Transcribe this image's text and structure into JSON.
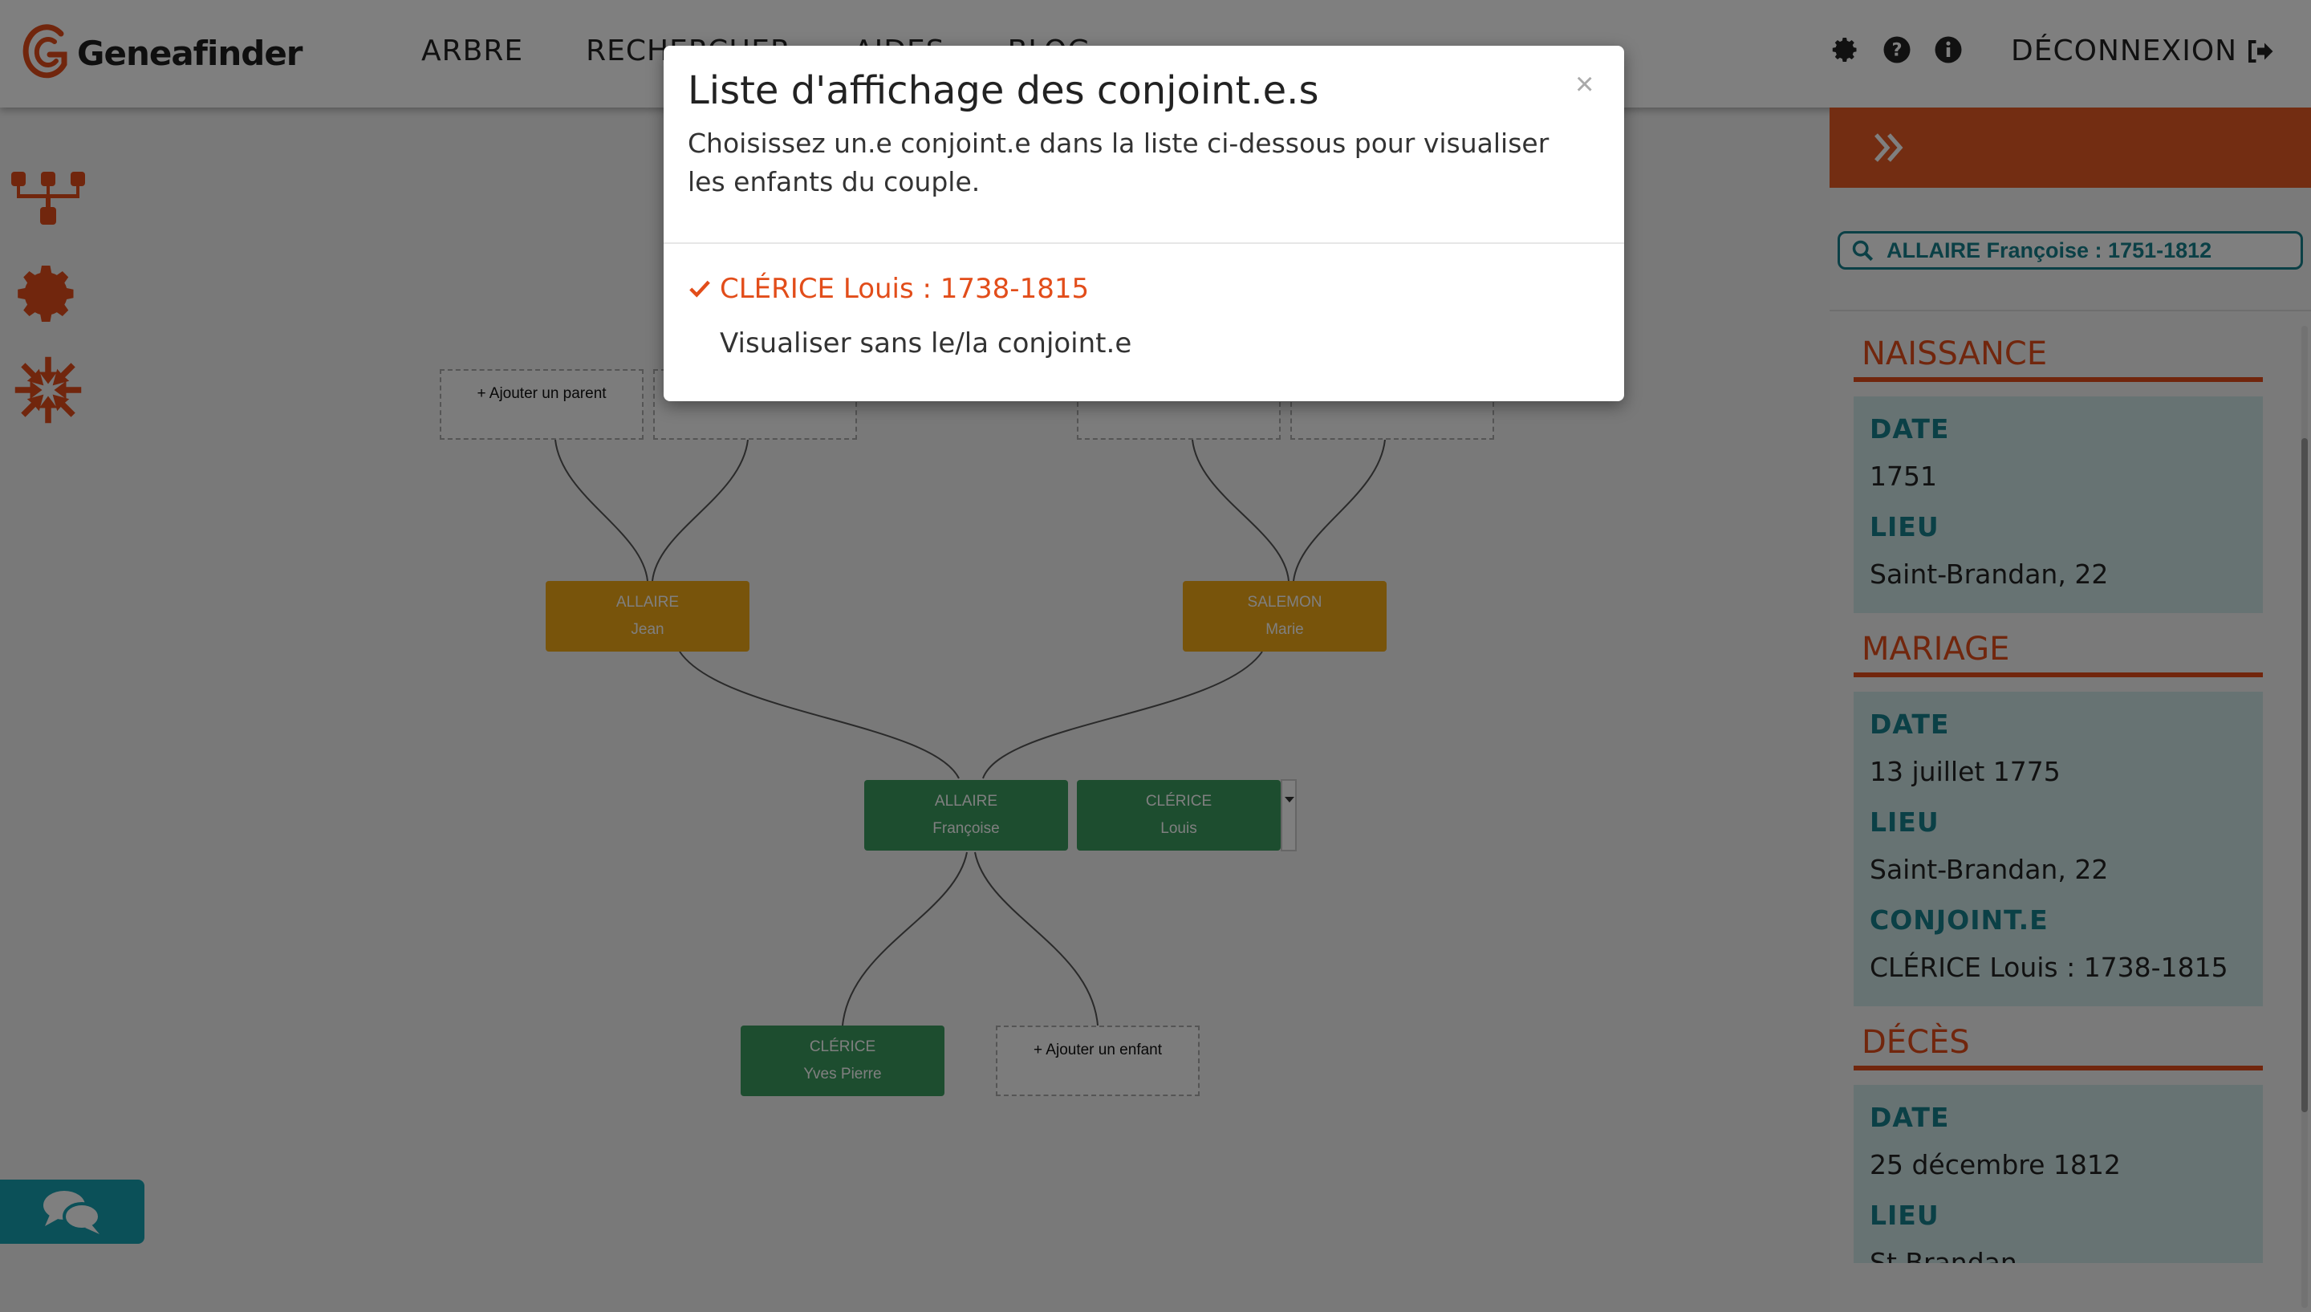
{
  "header": {
    "brand": "Geneafinder",
    "nav": [
      "ARBRE",
      "RECHERCHER",
      "AIDES",
      "BLOG"
    ],
    "logout_label": "DÉCONNEXION"
  },
  "icons": {
    "brand_color": "#e24d1a",
    "accent_teal": "#17808d",
    "person_yellow": "#f0a817",
    "person_green": "#3a9a5e"
  },
  "tree": {
    "parents": [
      {
        "last": "ALLAIRE",
        "first": "Jean"
      },
      {
        "last": "SALEMON",
        "first": "Marie"
      }
    ],
    "couple": [
      {
        "last": "ALLAIRE",
        "first": "Françoise"
      },
      {
        "last": "CLÉRICE",
        "first": "Louis"
      }
    ],
    "children": [
      {
        "last": "CLÉRICE",
        "first": "Yves Pierre"
      }
    ],
    "add_parent_label": "+ Ajouter un parent",
    "add_child_label": "+ Ajouter un enfant"
  },
  "panel": {
    "search_value": "ALLAIRE Françoise : 1751-1812",
    "sections": {
      "naissance": {
        "title": "NAISSANCE",
        "date_label": "DATE",
        "date": "1751",
        "lieu_label": "LIEU",
        "lieu": "Saint-Brandan, 22"
      },
      "mariage": {
        "title": "MARIAGE",
        "date_label": "DATE",
        "date": "13 juillet 1775",
        "lieu_label": "LIEU",
        "lieu": "Saint-Brandan, 22",
        "conjoint_label": "CONJOINT.E",
        "conjoint": "CLÉRICE Louis : 1738-1815"
      },
      "deces": {
        "title": "DÉCÈS",
        "date_label": "DATE",
        "date": "25 décembre 1812",
        "lieu_label": "LIEU",
        "lieu": "St Brandan"
      }
    }
  },
  "modal": {
    "title": "Liste d'affichage des conjoint.e.s",
    "close": "×",
    "description": "Choisissez un.e conjoint.e dans la liste ci-dessous pour visualiser les enfants du couple.",
    "options": [
      {
        "label": "CLÉRICE Louis : 1738-1815",
        "selected": true
      },
      {
        "label": "Visualiser sans le/la conjoint.e",
        "selected": false
      }
    ]
  }
}
